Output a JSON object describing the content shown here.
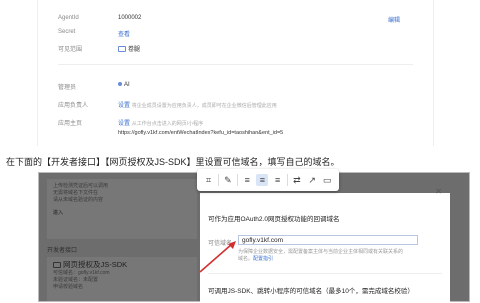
{
  "settings": {
    "agentid_label": "AgentId",
    "agentid_value": "1000002",
    "agentid_action": "编辑",
    "secret_label": "Secret",
    "secret_action": "查看",
    "visible_label": "可见范围",
    "visible_value": "卷腿",
    "admin_label": "管理员",
    "admin_value": "AI",
    "owner_label": "应用负责人",
    "owner_action": "设置",
    "owner_hint": "将企业成员设置为应用负责人，成员即可在企业微信后管理此应用",
    "home_label": "应用主页",
    "home_action": "设置",
    "home_hint": "从工作台点击进入的网页/小程序",
    "home_url": "https://gofly.v1kf.com/entWechatIndex?kefu_id=taoshihan&ent_id=5"
  },
  "caption": "在下面的【开发者接口】【网页授权及JS-SDK】里设置可信域名，填写自己的域名。",
  "screenshot": {
    "left_lines": [
      "上传检测凭证后可以调用",
      "无需将域名下文件在",
      "请从未域名验证的内容"
    ],
    "left_save": "进入",
    "dev_interface": "开发者接口",
    "jssdk_title": "网页授权及JS-SDK",
    "jssdk_domain": "可信域名：gofly.v1kf.com",
    "jssdk_sub": "未验证域名：未配置",
    "jssdk_apply": "申请校验域名",
    "dialog_title": "可作为应用OAuth2.0网页授权功能的回调域名",
    "domain_label": "可信域名",
    "domain_value": "gofly.v1kf.com",
    "dialog_note_1": "为保障企业数据安全，需配置备案主体与当前企业主体相同或有关联关系",
    "dialog_note_2": "的域名。",
    "config_help": "配置指引",
    "dialog_section": "可调用JS-SDK、跳转小程序的可信域名（最多10个，需完成域名校验）"
  },
  "colors": {
    "link": "#3a6fd0",
    "overlay": "#6d6d6d",
    "arrow": "#d32f2f"
  }
}
